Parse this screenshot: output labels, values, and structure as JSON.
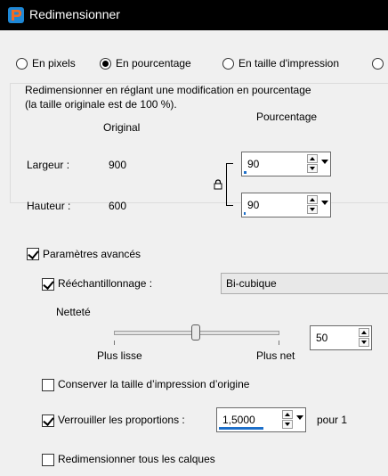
{
  "window": {
    "title": "Redimensionner"
  },
  "modes": [
    {
      "label": "En pixels",
      "checked": false
    },
    {
      "label": "En pourcentage",
      "checked": true
    },
    {
      "label": "En taille d'impression",
      "checked": false
    }
  ],
  "group": {
    "description_line1": "Redimensionner en réglant une modification en pourcentage",
    "description_line2": "(la taille originale est de 100 %).",
    "original_header": "Original",
    "percent_header": "Pourcentage",
    "width_label": "Largeur :",
    "width_original": "900",
    "width_percent": "90",
    "height_label": "Hauteur :",
    "height_original": "600",
    "height_percent": "90"
  },
  "advanced": {
    "label": "Paramètres avancés",
    "checked": true,
    "resample_label": "Rééchantillonnage :",
    "resample_checked": true,
    "resample_method": "Bi-cubique",
    "sharpness_label": "Netteté",
    "sharpness_min_label": "Plus lisse",
    "sharpness_max_label": "Plus net",
    "sharpness_value": "50",
    "keep_print_size_label": "Conserver la taille d’impression d’origine",
    "keep_print_size_checked": false,
    "lock_ratio_label": "Verrouiller les proportions :",
    "lock_ratio_checked": true,
    "ratio_value": "1,5000",
    "ratio_suffix": "pour 1",
    "resize_all_layers_label": "Redimensionner tous les calques",
    "resize_all_layers_checked": false
  },
  "colors": {
    "accent": "#1d6fc9",
    "titlebar": "#000000",
    "background": "#f0f0f0"
  }
}
